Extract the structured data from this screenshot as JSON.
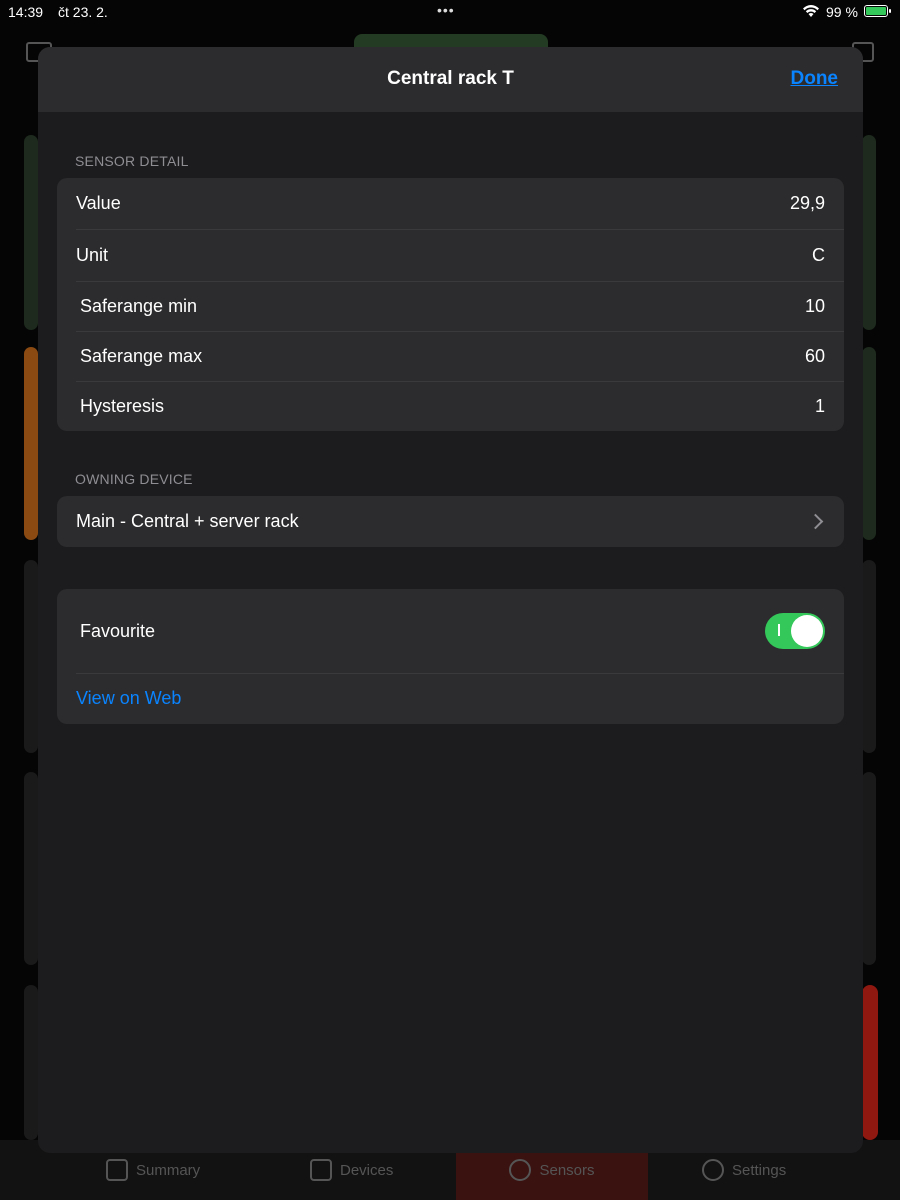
{
  "status_bar": {
    "time": "14:39",
    "date": "čt 23. 2.",
    "dots": "•••",
    "battery_pct": "99 %"
  },
  "sheet": {
    "title": "Central rack T",
    "done_label": "Done",
    "sensor_detail": {
      "section_label": "SENSOR DETAIL",
      "rows": [
        {
          "label": "Value",
          "value": "29,9"
        },
        {
          "label": "Unit",
          "value": "C"
        },
        {
          "label": "Saferange min",
          "value": "10"
        },
        {
          "label": "Saferange max",
          "value": "60"
        },
        {
          "label": "Hysteresis",
          "value": "1"
        }
      ]
    },
    "owning_device": {
      "section_label": "OWNING DEVICE",
      "device_name": "Main - Central + server rack"
    },
    "actions": {
      "favourite_label": "Favourite",
      "favourite_on": true,
      "view_web_label": "View on Web"
    }
  },
  "tabbar": {
    "tabs": [
      {
        "label": "Summary",
        "icon": "document-chart-icon"
      },
      {
        "label": "Devices",
        "icon": "server-rack-icon"
      },
      {
        "label": "Sensors",
        "icon": "pulse-icon"
      },
      {
        "label": "Settings",
        "icon": "gear-icon"
      }
    ]
  },
  "colors": {
    "accent": "#0a84ff",
    "toggle_on": "#34c759",
    "sheet_bg": "#1c1c1e",
    "group_bg": "#2c2c2e"
  }
}
